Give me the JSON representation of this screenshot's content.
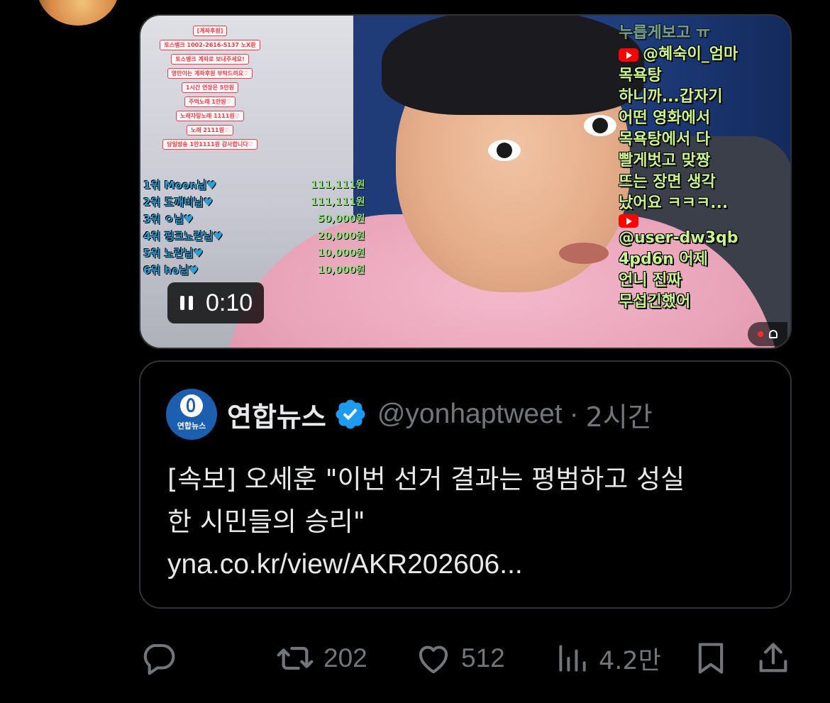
{
  "video": {
    "timer": "0:10",
    "overlay_red_lines": [
      "[계좌후원]",
      "토스뱅크 1002-2616-5137 노X환",
      "토스뱅크 계좌로 보내주세요!",
      "영만이는 계좌후원 부탁드려요♡",
      "1시간 연장은 5만원",
      "주먹노래 1만원♡",
      "노래자랑노래 1111원♡",
      "노래 2111원♡",
      "당일방송 1만1111원 감사합니다♡"
    ],
    "overlay_rank_lines": [
      "1위 Moon님♥",
      "2위 도깨비님♥",
      "3위 ㅇ님♥",
      "4위 핑크노란님♥",
      "5위 노란님♥",
      "6위 ho님♥"
    ],
    "overlay_amount_lines": [
      "111,111원",
      "111,111원",
      "50,000원",
      "20,000원",
      "10,000원",
      "10,000원"
    ],
    "overlay_chat": {
      "top_partial": "누릅게보고 ㅠ",
      "author1": "@혜숙이_엄마",
      "message1_lines": [
        "목욕탕",
        "하니까...갑자기",
        "어떤 영화에서",
        "목욕탕에서 다",
        "빨게벗고 맞짱",
        "뜨는 장면 생각",
        "났어요 ㅋㅋㅋ..."
      ],
      "author2_lines": [
        "@user-dw3qb",
        "4pd6n 어제"
      ],
      "message2_lines": [
        "언니 진짜",
        "무섭긴했어"
      ]
    }
  },
  "quote": {
    "avatar_label": "연합뉴스",
    "name": "연합뉴스",
    "handle": "@yonhaptweet",
    "separator": "·",
    "time": "2시간",
    "body_line1": "[속보] 오세훈 \"이번 선거 결과는 평범하고 성실",
    "body_line2": "한 시민들의 승리\"",
    "link": "yna.co.kr/view/AKR202606..."
  },
  "actions": {
    "reply_icon": "reply-icon",
    "retweet_count": "202",
    "like_count": "512",
    "views_count": "4.2만",
    "bookmark_icon": "bookmark-icon",
    "share_icon": "share-icon"
  },
  "colors": {
    "background": "#000000",
    "text": "#e7e9ea",
    "muted": "#71767b",
    "border": "#2f3336",
    "verified": "#1d9bf0"
  }
}
